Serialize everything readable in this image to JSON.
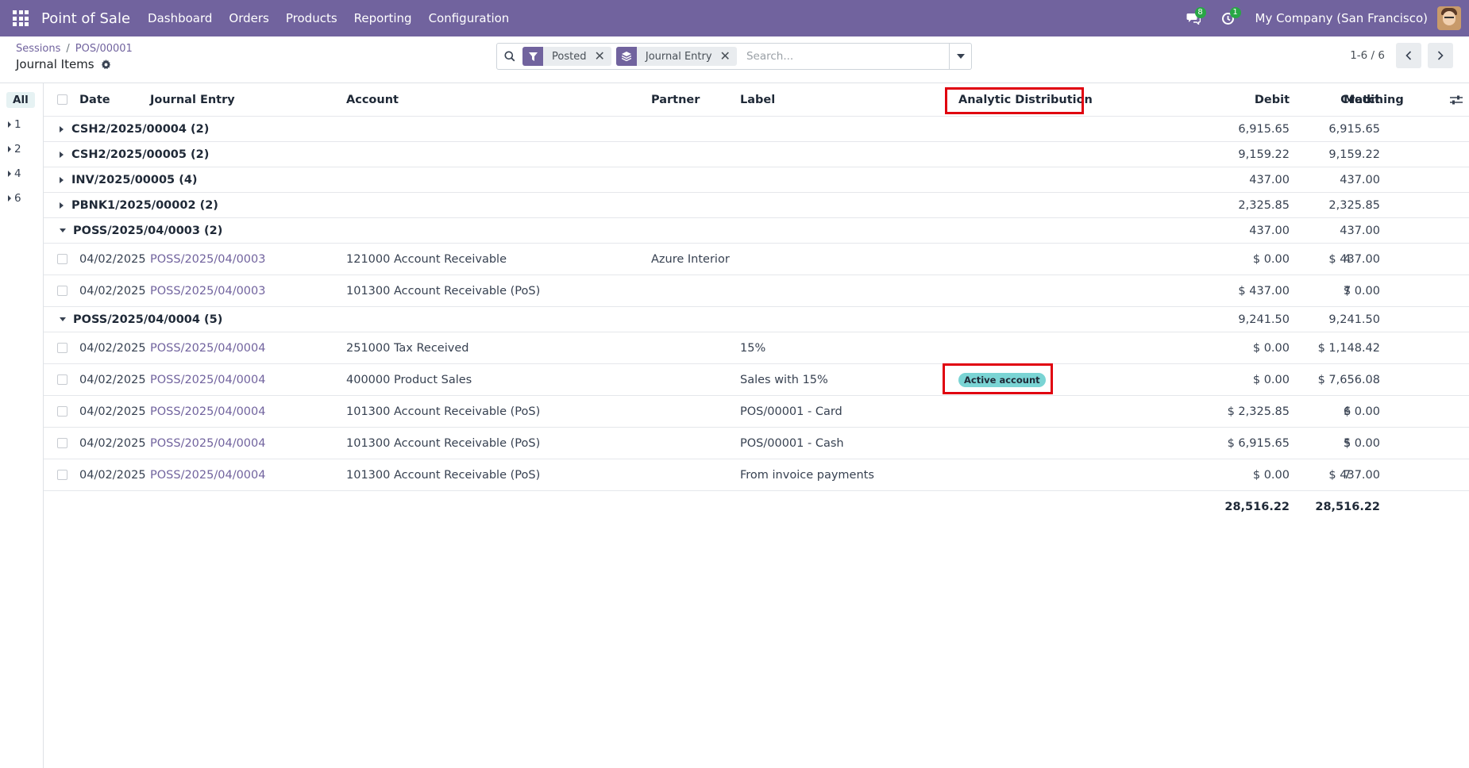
{
  "navbar": {
    "app_name": "Point of Sale",
    "menu": [
      "Dashboard",
      "Orders",
      "Products",
      "Reporting",
      "Configuration"
    ],
    "messages_count": "8",
    "activities_count": "1",
    "company": "My Company (San Francisco)"
  },
  "breadcrumb": {
    "parent": "Sessions",
    "sep": "/",
    "current": "POS/00001"
  },
  "page_title": "Journal Items",
  "search": {
    "facets": [
      {
        "label": "Posted",
        "icon": "filter-icon"
      },
      {
        "label": "Journal Entry",
        "icon": "layers-icon"
      }
    ],
    "placeholder": "Search..."
  },
  "pager": {
    "value": "1-6 / 6"
  },
  "sidebar": {
    "items": [
      "All",
      "1",
      "2",
      "4",
      "6"
    ]
  },
  "table": {
    "headers": {
      "date": "Date",
      "journal_entry": "Journal Entry",
      "account": "Account",
      "partner": "Partner",
      "label": "Label",
      "analytic": "Analytic Distribution",
      "debit": "Debit",
      "credit": "Credit",
      "matching": "Matching"
    },
    "groups": [
      {
        "name": "CSH2/2025/00004 (2)",
        "debit": "6,915.65",
        "credit": "6,915.65",
        "expanded": false
      },
      {
        "name": "CSH2/2025/00005 (2)",
        "debit": "9,159.22",
        "credit": "9,159.22",
        "expanded": false
      },
      {
        "name": "INV/2025/00005 (4)",
        "debit": "437.00",
        "credit": "437.00",
        "expanded": false
      },
      {
        "name": "PBNK1/2025/00002 (2)",
        "debit": "2,325.85",
        "credit": "2,325.85",
        "expanded": false
      },
      {
        "name": "POSS/2025/04/0003 (2)",
        "debit": "437.00",
        "credit": "437.00",
        "expanded": true,
        "rows": [
          {
            "date": "04/02/2025",
            "entry": "POSS/2025/04/0003",
            "account": "121000 Account Receivable",
            "partner": "Azure Interior",
            "label": "",
            "analytic": "",
            "debit": "$ 0.00",
            "credit": "$ 437.00",
            "matching": "4"
          },
          {
            "date": "04/02/2025",
            "entry": "POSS/2025/04/0003",
            "account": "101300 Account Receivable (PoS)",
            "partner": "",
            "label": "",
            "analytic": "",
            "debit": "$ 437.00",
            "credit": "$ 0.00",
            "matching": "7"
          }
        ]
      },
      {
        "name": "POSS/2025/04/0004 (5)",
        "debit": "9,241.50",
        "credit": "9,241.50",
        "expanded": true,
        "rows": [
          {
            "date": "04/02/2025",
            "entry": "POSS/2025/04/0004",
            "account": "251000 Tax Received",
            "partner": "",
            "label": "15%",
            "analytic": "",
            "debit": "$ 0.00",
            "credit": "$ 1,148.42",
            "matching": ""
          },
          {
            "date": "04/02/2025",
            "entry": "POSS/2025/04/0004",
            "account": "400000 Product Sales",
            "partner": "",
            "label": "Sales with 15%",
            "analytic": "Active account",
            "debit": "$ 0.00",
            "credit": "$ 7,656.08",
            "matching": ""
          },
          {
            "date": "04/02/2025",
            "entry": "POSS/2025/04/0004",
            "account": "101300 Account Receivable (PoS)",
            "partner": "",
            "label": "POS/00001 - Card",
            "analytic": "",
            "debit": "$ 2,325.85",
            "credit": "$ 0.00",
            "matching": "6"
          },
          {
            "date": "04/02/2025",
            "entry": "POSS/2025/04/0004",
            "account": "101300 Account Receivable (PoS)",
            "partner": "",
            "label": "POS/00001 - Cash",
            "analytic": "",
            "debit": "$ 6,915.65",
            "credit": "$ 0.00",
            "matching": "5"
          },
          {
            "date": "04/02/2025",
            "entry": "POSS/2025/04/0004",
            "account": "101300 Account Receivable (PoS)",
            "partner": "",
            "label": "From invoice payments",
            "analytic": "",
            "debit": "$ 0.00",
            "credit": "$ 437.00",
            "matching": "7"
          }
        ]
      }
    ],
    "totals": {
      "debit": "28,516.22",
      "credit": "28,516.22"
    }
  },
  "colors": {
    "brand": "#71639e",
    "highlight": "#e0000f",
    "tag_bg": "#7ad4d4",
    "badge": "#28a745"
  }
}
